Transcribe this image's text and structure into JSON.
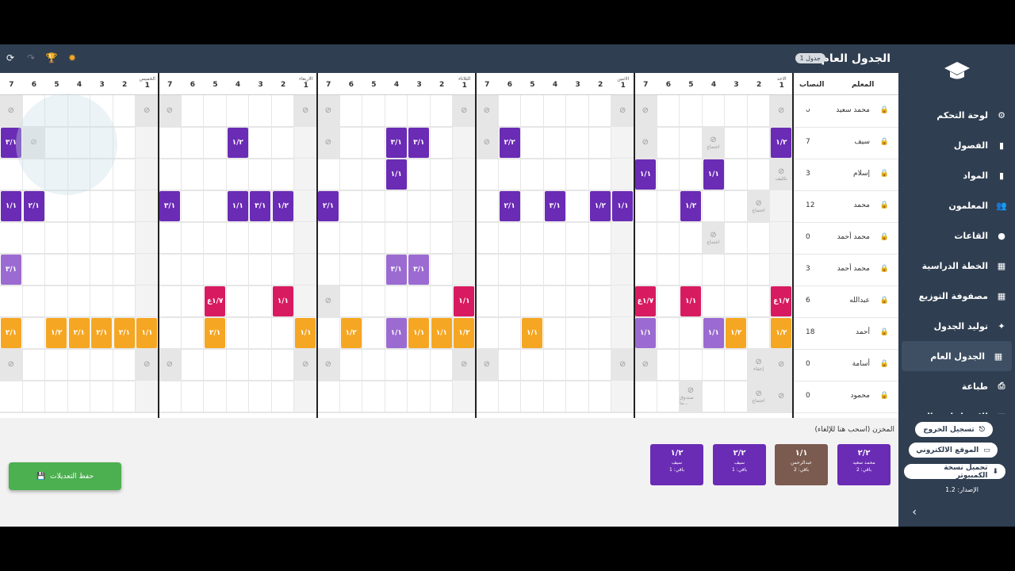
{
  "topbar": {
    "title": "الجدول العام",
    "badge": "جدول 1",
    "icons": [
      "refresh-icon",
      "redo-icon",
      "trophy-icon",
      "bug-icon"
    ]
  },
  "sidebar": {
    "items": [
      {
        "label": "لوحة التحكم",
        "icon": "gear-icon",
        "active": false
      },
      {
        "label": "الفصول",
        "icon": "door-icon",
        "active": false
      },
      {
        "label": "المواد",
        "icon": "book-icon",
        "active": false
      },
      {
        "label": "المعلمون",
        "icon": "people-icon",
        "active": false
      },
      {
        "label": "القاعات",
        "icon": "pin-icon",
        "active": false
      },
      {
        "label": "الخطة الدراسية",
        "icon": "grid-icon",
        "active": false
      },
      {
        "label": "مصفوفة التوزيع",
        "icon": "grid-icon",
        "active": false
      },
      {
        "label": "توليد الجدول",
        "icon": "sparkle-icon",
        "active": false
      },
      {
        "label": "الجدول العام",
        "icon": "dashboard-icon",
        "active": true
      },
      {
        "label": "طباعة",
        "icon": "print-icon",
        "active": false
      },
      {
        "label": "الاحصائيات والنسخ",
        "icon": "grid-icon",
        "active": false
      }
    ],
    "logout": "تسجيل الخروج",
    "website": "الموقع الالكتروني",
    "download": "تحميل نسخة الكمبيوتر",
    "version": "الإصدار: 1.2"
  },
  "grid": {
    "header_teacher": "المعلم",
    "header_quota": "النصاب",
    "days": [
      "الاحد",
      "الاثنين",
      "الثلاثاء",
      "الاربعاء",
      "الخميس"
    ],
    "periods": [
      "1",
      "2",
      "3",
      "4",
      "5",
      "6",
      "7"
    ],
    "teachers": [
      {
        "name": "محمد سعيد",
        "quota": "0"
      },
      {
        "name": "سيف",
        "quota": "7"
      },
      {
        "name": "إسلام",
        "quota": "3"
      },
      {
        "name": "محمد",
        "quota": "12"
      },
      {
        "name": "محمد أحمد",
        "quota": "0"
      },
      {
        "name": "محمد أحمد",
        "quota": "3"
      },
      {
        "name": "عبدالله",
        "quota": "6"
      },
      {
        "name": "أحمد",
        "quota": "18"
      },
      {
        "name": "أسامة",
        "quota": "0"
      },
      {
        "name": "محمود",
        "quota": "0"
      }
    ],
    "block_labels": {
      "meeting": "اجتماع",
      "supervision": "إشراف",
      "assignment": "تكليف",
      "entitlement": "إعفاء",
      "fund": "صندوق ما..."
    },
    "colors": {
      "purple": "#6a2bb5",
      "lightpurple": "#9b6bd1",
      "pink": "#d81b60",
      "orange": "#f5a623",
      "brown": "#7b5b4f",
      "blue": "#2196f3"
    }
  },
  "store": {
    "title": "المخزن (اسحب هنا للإلغاء)",
    "cards": [
      {
        "code": "٢/٢",
        "teacher": "محمد سعيد",
        "remaining": "باقي: 2",
        "color": "#6a2bb5"
      },
      {
        "code": "١/١",
        "teacher": "عبدالرحمن",
        "remaining": "باقي: 2",
        "color": "#7b5b4f"
      },
      {
        "code": "٢/٢",
        "teacher": "سيف",
        "remaining": "باقي: 1",
        "color": "#6a2bb5"
      },
      {
        "code": "١/٢",
        "teacher": "سيف",
        "remaining": "باقي: 1",
        "color": "#6a2bb5"
      }
    ]
  },
  "save_label": "حفظ التعديلات"
}
